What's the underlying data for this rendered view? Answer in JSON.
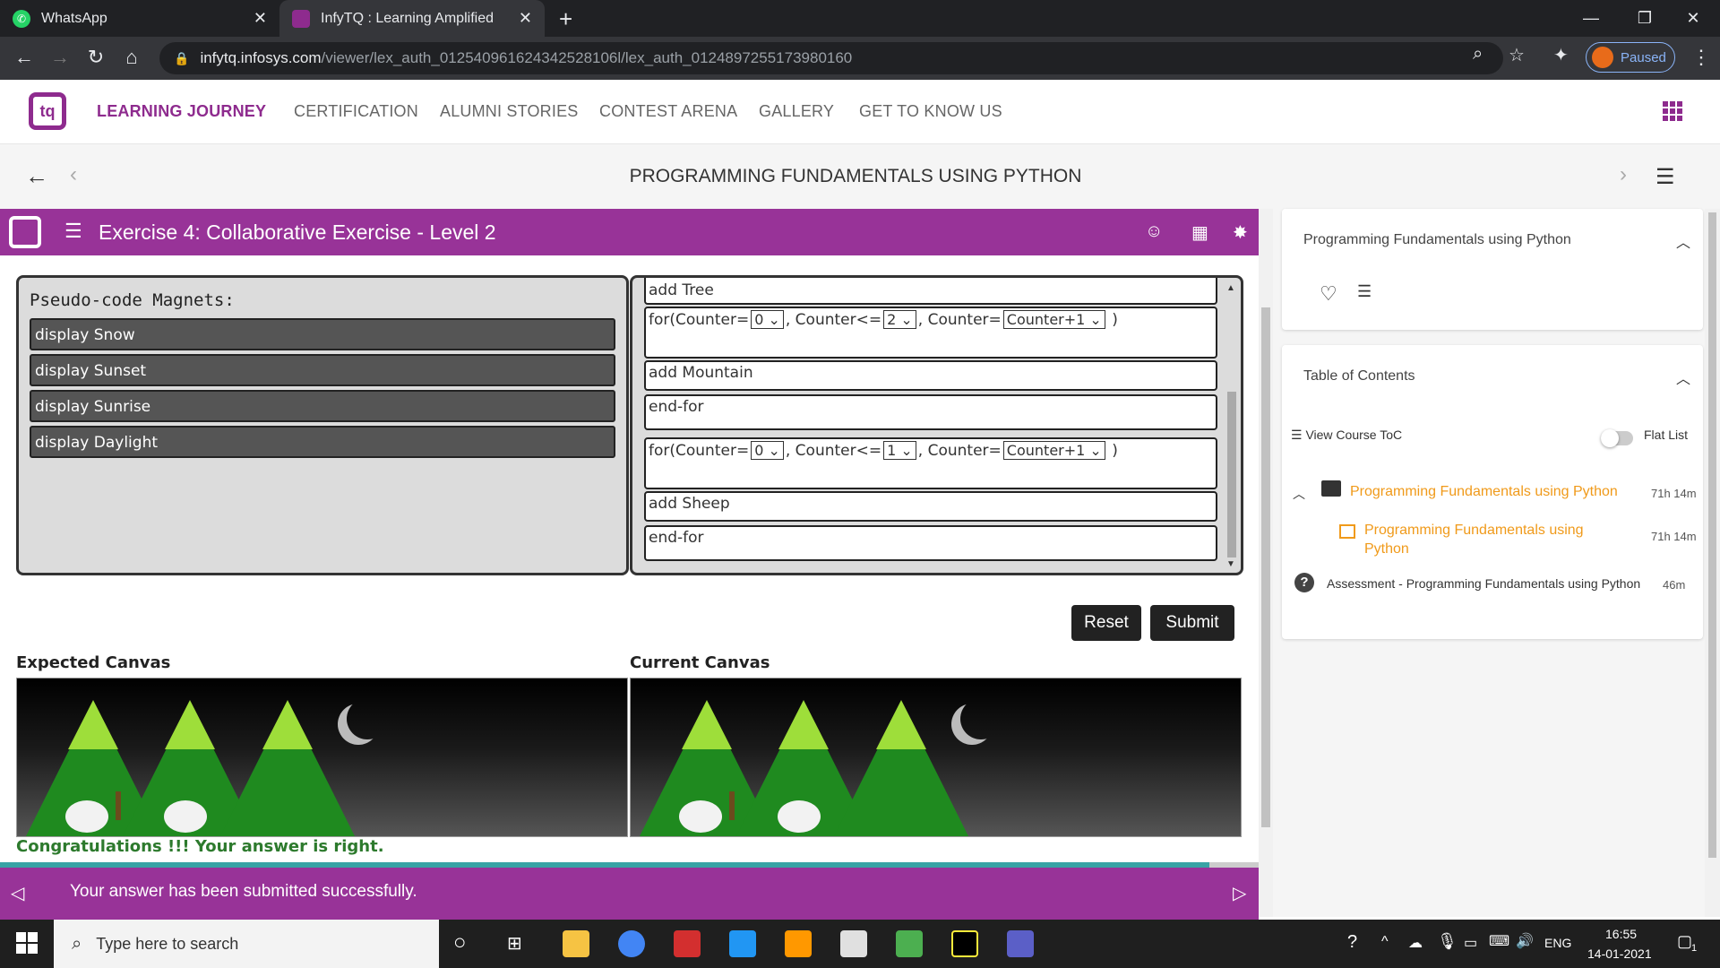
{
  "browser": {
    "tabs": [
      {
        "title": "WhatsApp",
        "active": false
      },
      {
        "title": "InfyTQ : Learning Amplified",
        "active": true
      }
    ],
    "url_host": "infytq.infosys.com",
    "url_path": "/viewer/lex_auth_012540961624342528106l/lex_auth_0124897255173980160",
    "profile_status": "Paused"
  },
  "site_nav": {
    "items": [
      "LEARNING JOURNEY",
      "CERTIFICATION",
      "ALUMNI STORIES",
      "CONTEST ARENA",
      "GALLERY",
      "GET TO KNOW US"
    ]
  },
  "course_bar": {
    "title": "PROGRAMMING FUNDAMENTALS USING PYTHON"
  },
  "exercise": {
    "title": "Exercise 4: Collaborative Exercise - Level 2",
    "magnets_title": "Pseudo-code Magnets:",
    "magnets": [
      "display Snow",
      "display Sunset",
      "display Sunrise",
      "display Daylight"
    ],
    "code_lines": {
      "l1": "add Tree",
      "for1": {
        "prefix": "for(Counter=",
        "start": "0",
        "mid": ", Counter<=",
        "limit": "2",
        "mid2": ", Counter=",
        "step": "Counter+1",
        "suffix": " )"
      },
      "l3": "add Mountain",
      "l4": "end-for",
      "for2": {
        "prefix": "for(Counter=",
        "start": "0",
        "mid": ", Counter<=",
        "limit": "1",
        "mid2": ", Counter=",
        "step": "Counter+1",
        "suffix": " )"
      },
      "l6": "add Sheep",
      "l7": "end-for"
    },
    "reset_label": "Reset",
    "submit_label": "Submit",
    "expected_label": "Expected Canvas",
    "current_label": "Current Canvas",
    "result_message": "Congratulations !!! Your answer is right.",
    "footer_message": "Your answer has been submitted successfully."
  },
  "sidebar": {
    "course_card_title": "Programming Fundamentals using Python",
    "toc_title": "Table of Contents",
    "view_toc_label": "View Course ToC",
    "flat_list_label": "Flat List",
    "items": [
      {
        "label": "Programming Fundamentals using Python",
        "duration": "71h 14m"
      },
      {
        "label": "Programming Fundamentals using Python",
        "duration": "71h 14m"
      },
      {
        "label": "Assessment - Programming Fundamentals using Python",
        "duration": "46m"
      }
    ]
  },
  "taskbar": {
    "search_placeholder": "Type here to search",
    "language": "ENG",
    "time": "16:55",
    "date": "14-01-2021",
    "notification_count": "1"
  },
  "colors": {
    "brand_purple": "#983398",
    "accent_orange": "#f09a1a",
    "success_green": "#2d7a2d"
  }
}
